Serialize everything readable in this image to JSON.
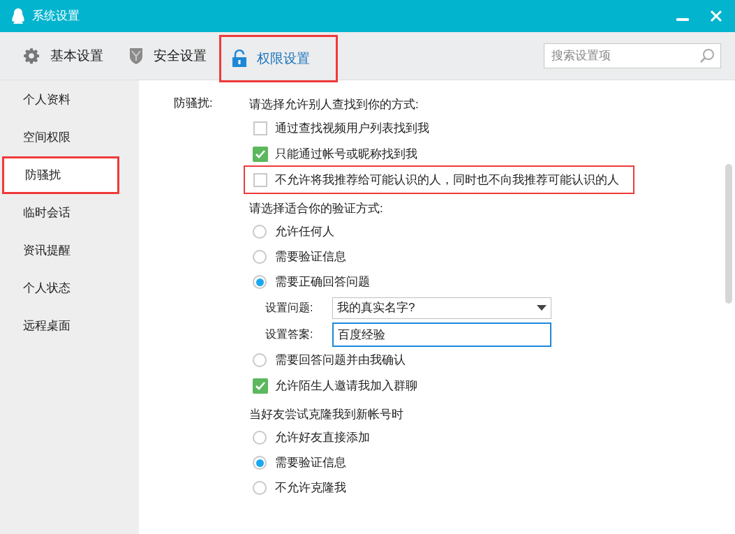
{
  "window": {
    "title": "系统设置"
  },
  "tabs": [
    {
      "label": "基本设置",
      "selected": false,
      "highlighted": false
    },
    {
      "label": "安全设置",
      "selected": false,
      "highlighted": false
    },
    {
      "label": "权限设置",
      "selected": true,
      "highlighted": true
    }
  ],
  "search": {
    "placeholder": "搜索设置项"
  },
  "sidebar": {
    "items": [
      {
        "label": "个人资料",
        "selected": false,
        "highlighted": false
      },
      {
        "label": "空间权限",
        "selected": false,
        "highlighted": false
      },
      {
        "label": "防骚扰",
        "selected": true,
        "highlighted": true
      },
      {
        "label": "临时会话",
        "selected": false,
        "highlighted": false
      },
      {
        "label": "资讯提醒",
        "selected": false,
        "highlighted": false
      },
      {
        "label": "个人状态",
        "selected": false,
        "highlighted": false
      },
      {
        "label": "远程桌面",
        "selected": false,
        "highlighted": false
      }
    ]
  },
  "content": {
    "section_label": "防骚扰:",
    "groups": [
      {
        "heading": "请选择允许别人查找到你的方式:",
        "items": [
          {
            "kind": "checkbox",
            "label": "通过查找视频用户列表找到我",
            "checked": false,
            "highlighted": false
          },
          {
            "kind": "checkbox",
            "label": "只能通过帐号或昵称找到我",
            "checked": true,
            "highlighted": false
          },
          {
            "kind": "checkbox",
            "label": "不允许将我推荐给可能认识的人，同时也不向我推荐可能认识的人",
            "checked": false,
            "highlighted": true
          }
        ]
      },
      {
        "heading": "请选择适合你的验证方式:",
        "items": [
          {
            "kind": "radio",
            "label": "允许任何人",
            "selected": false
          },
          {
            "kind": "radio",
            "label": "需要验证信息",
            "selected": false
          },
          {
            "kind": "radio",
            "label": "需要正确回答问题",
            "selected": true
          },
          {
            "kind": "select",
            "label": "设置问题:",
            "value": "我的真实名字?"
          },
          {
            "kind": "input",
            "label": "设置答案:",
            "value": "百度经验",
            "focused": true
          },
          {
            "kind": "radio",
            "label": "需要回答问题并由我确认",
            "selected": false
          },
          {
            "kind": "checkbox",
            "label": "允许陌生人邀请我加入群聊",
            "checked": true,
            "highlighted": false
          }
        ]
      },
      {
        "heading": "当好友尝试克隆我到新帐号时",
        "items": [
          {
            "kind": "radio",
            "label": "允许好友直接添加",
            "selected": false
          },
          {
            "kind": "radio",
            "label": "需要验证信息",
            "selected": true
          },
          {
            "kind": "radio",
            "label": "不允许克隆我",
            "selected": false
          }
        ]
      }
    ]
  }
}
